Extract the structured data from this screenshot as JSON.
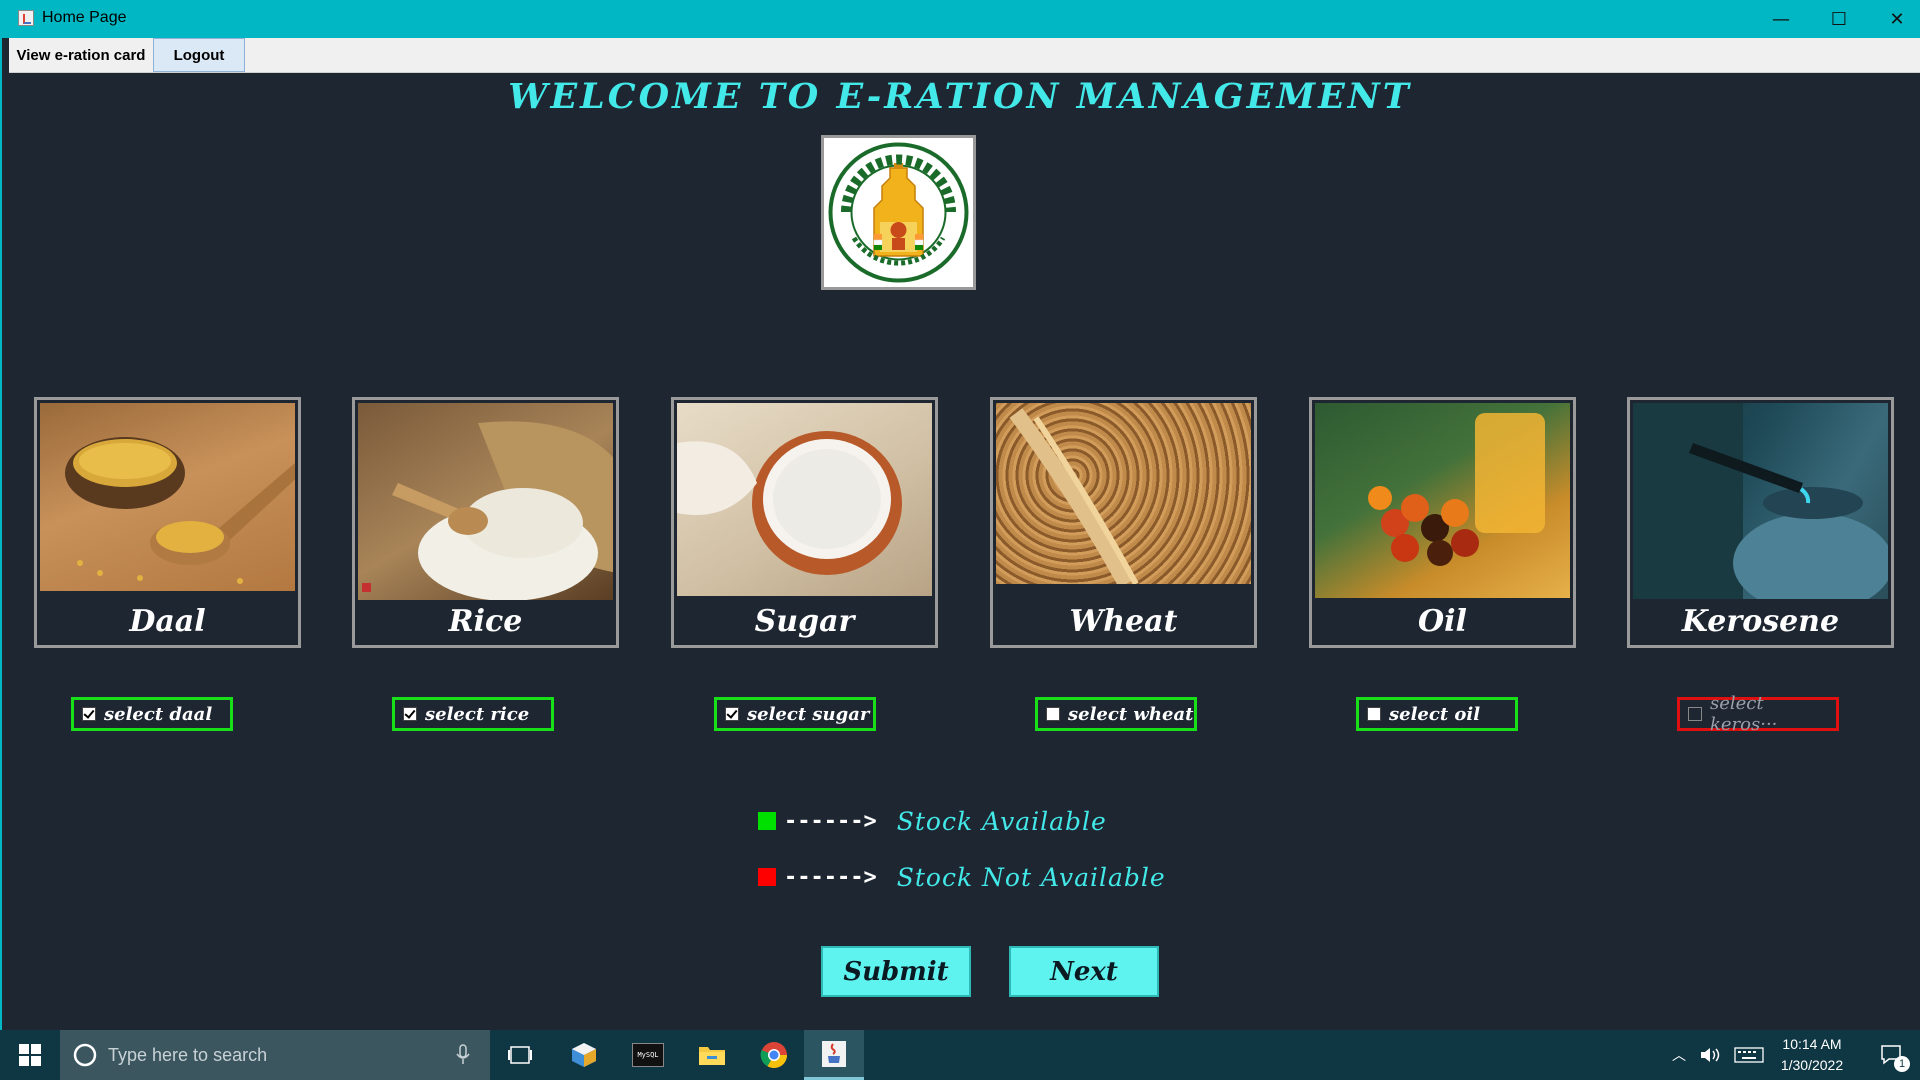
{
  "window": {
    "title": "Home Page",
    "minimize": "—",
    "maximize": "☐",
    "close": "✕"
  },
  "menu": {
    "view_card": "View e-ration card",
    "logout": "Logout"
  },
  "heading": "WELCOME TO E-RATION MANAGEMENT",
  "items": [
    {
      "name": "Daal",
      "checkbox_label": "select daal",
      "checked": true,
      "stock": "available"
    },
    {
      "name": "Rice",
      "checkbox_label": "select rice",
      "checked": true,
      "stock": "available"
    },
    {
      "name": "Sugar",
      "checkbox_label": "select sugar",
      "checked": true,
      "stock": "available"
    },
    {
      "name": "Wheat",
      "checkbox_label": "select wheat",
      "checked": false,
      "stock": "available"
    },
    {
      "name": "Oil",
      "checkbox_label": "select oil",
      "checked": false,
      "stock": "available"
    },
    {
      "name": "Kerosene",
      "checkbox_label": "select keros···",
      "checked": false,
      "stock": "not-available"
    }
  ],
  "legend": {
    "arrow": "------>",
    "available": "Stock Available",
    "not_available": "Stock Not Available",
    "available_color": "#00e000",
    "not_available_color": "#ff0000"
  },
  "buttons": {
    "submit": "Submit",
    "next": "Next"
  },
  "taskbar": {
    "search_placeholder": "Type here to search",
    "mysql_label": "MySQL",
    "time": "10:14 AM",
    "date": "1/30/2022",
    "notification_count": "1"
  }
}
